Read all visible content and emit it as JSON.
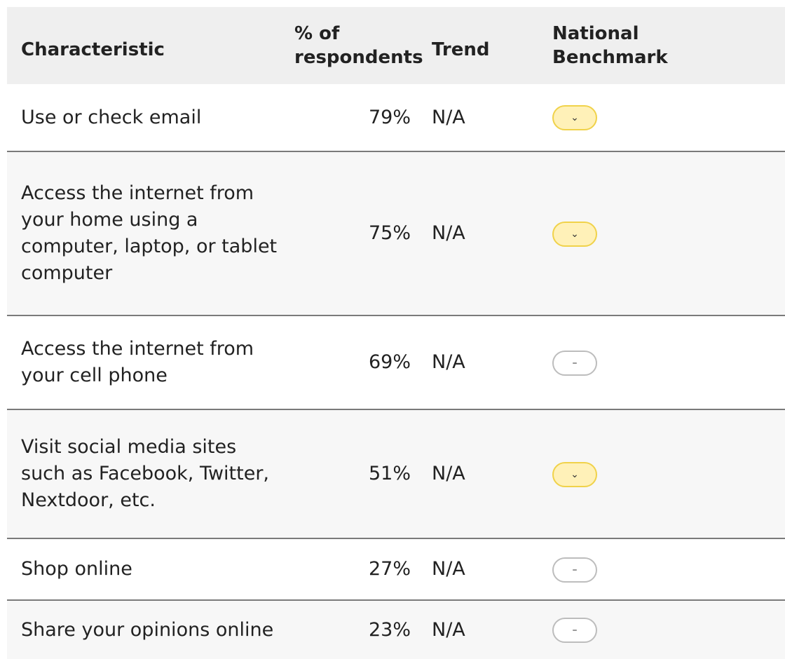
{
  "table": {
    "headers": {
      "characteristic": "Characteristic",
      "percent_line1": "% of",
      "percent_line2": "respondents",
      "trend": "Trend",
      "benchmark_line1": "National",
      "benchmark_line2": "Benchmark"
    },
    "rows": [
      {
        "characteristic": "Use or check email",
        "percent": "79%",
        "trend": "N/A",
        "benchmark": "similar",
        "benchmark_glyph": "⌄"
      },
      {
        "characteristic": "Access the internet from your home using a computer, laptop, or tablet computer",
        "percent": "75%",
        "trend": "N/A",
        "benchmark": "similar",
        "benchmark_glyph": "⌄"
      },
      {
        "characteristic": "Access the internet from your cell phone",
        "percent": "69%",
        "trend": "N/A",
        "benchmark": "none",
        "benchmark_glyph": "–"
      },
      {
        "characteristic": "Visit social media sites such as Facebook, Twitter, Nextdoor, etc.",
        "percent": "51%",
        "trend": "N/A",
        "benchmark": "similar",
        "benchmark_glyph": "⌄"
      },
      {
        "characteristic": "Shop online",
        "percent": "27%",
        "trend": "N/A",
        "benchmark": "none",
        "benchmark_glyph": "–"
      },
      {
        "characteristic": "Share your opinions online",
        "percent": "23%",
        "trend": "N/A",
        "benchmark": "none",
        "benchmark_glyph": "–"
      }
    ]
  },
  "colors": {
    "header_bg": "#efefef",
    "similar_fill": "#fff1b8",
    "similar_border": "#f0d24a",
    "none_border": "#bdbdbd",
    "row_divider": "#7a7a7a"
  }
}
